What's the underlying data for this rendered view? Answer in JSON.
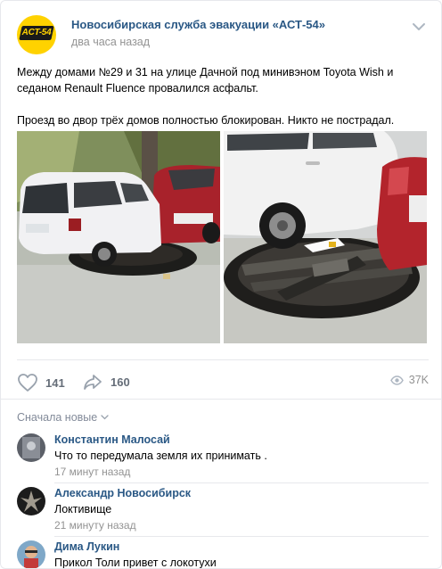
{
  "post": {
    "author": "Новосибирская служба эвакуации «АСТ-54»",
    "logo_text": "ACT-54",
    "time": "два часа назад",
    "paragraphs": [
      "Между домами №29 и 31 на улице Дачной под минивэном Toyota Wish и седаном Renault Fluence провалился асфальт.",
      "Проезд во двор трёх домов полностью блокирован. Никто не пострадал."
    ],
    "likes": "141",
    "shares": "160",
    "views": "37K"
  },
  "comments": {
    "sort_label": "Сначала новые",
    "items": [
      {
        "name": "Константин Малосай",
        "text": "Что то передумала земля их принимать .",
        "time": "17 минут назад"
      },
      {
        "name": "Александр Новосибирск",
        "text": "Локтивище",
        "time": "21 минуту назад"
      },
      {
        "name": "Дима Лукин",
        "text": "Прикол Толи привет с локотухи",
        "time": ""
      }
    ]
  },
  "colors": {
    "link": "#2a5885",
    "muted": "#939393",
    "brand_yellow": "#ffd200"
  },
  "icons": {
    "like": "heart-icon",
    "share": "share-arrow-icon",
    "views": "eye-icon",
    "more": "chevron-down-icon",
    "sort": "chevron-down-icon"
  }
}
